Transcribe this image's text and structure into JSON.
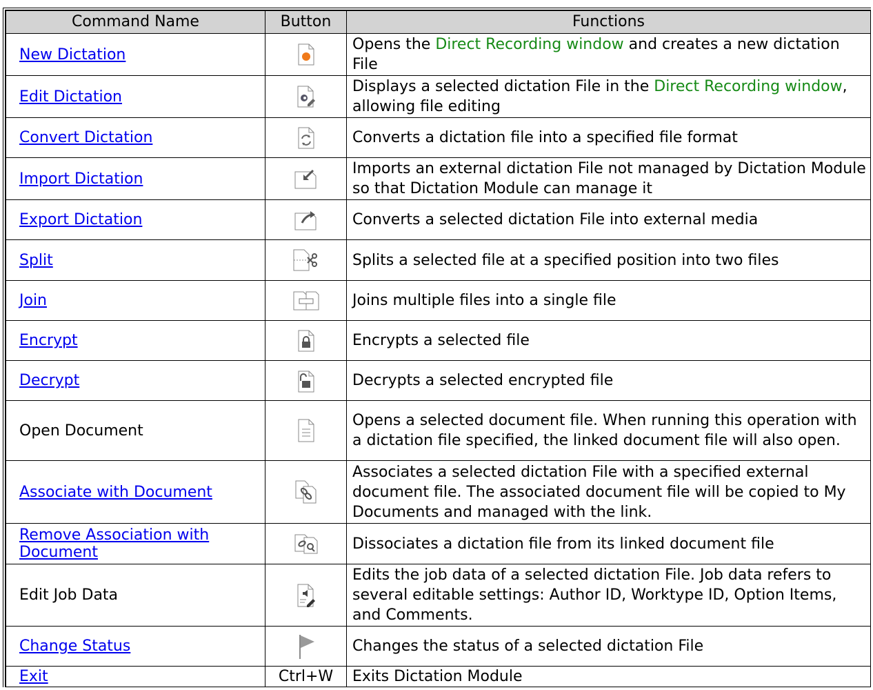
{
  "headers": {
    "command_name": "Command Name",
    "button": "Button",
    "functions": "Functions"
  },
  "rows": [
    {
      "name": "New Dictation",
      "linked": true,
      "icon": "new-dictation-icon",
      "func": [
        {
          "t": "Opens the ",
          "g": false
        },
        {
          "t": "Direct Recording window",
          "g": true
        },
        {
          "t": " and creates a new dictation File",
          "g": false
        }
      ]
    },
    {
      "name": "Edit Dictation",
      "linked": true,
      "icon": "edit-dictation-icon",
      "func": [
        {
          "t": "Displays a selected dictation File in the ",
          "g": false
        },
        {
          "t": "Direct Recording window",
          "g": true
        },
        {
          "t": ", allowing file editing",
          "g": false
        }
      ]
    },
    {
      "name": "Convert Dictation",
      "linked": true,
      "icon": "convert-dictation-icon",
      "func": [
        {
          "t": "Converts a dictation file into a specified file format",
          "g": false
        }
      ]
    },
    {
      "name": "Import Dictation",
      "linked": true,
      "icon": "import-dictation-icon",
      "func": [
        {
          "t": "Imports an external dictation File not managed by Dictation Module so that Dictation Module can manage it",
          "g": false
        }
      ]
    },
    {
      "name": "Export Dictation",
      "linked": true,
      "icon": "export-dictation-icon",
      "func": [
        {
          "t": "Converts a selected dictation File into external media",
          "g": false
        }
      ]
    },
    {
      "name": "Split",
      "linked": true,
      "icon": "split-icon",
      "func": [
        {
          "t": "Splits a selected file at a specified position into two files",
          "g": false
        }
      ]
    },
    {
      "name": "Join",
      "linked": true,
      "icon": "join-icon",
      "func": [
        {
          "t": "Joins multiple files into a single file",
          "g": false
        }
      ]
    },
    {
      "name": "Encrypt",
      "linked": true,
      "icon": "encrypt-icon",
      "func": [
        {
          "t": "Encrypts a selected file",
          "g": false
        }
      ]
    },
    {
      "name": "Decrypt",
      "linked": true,
      "icon": "decrypt-icon",
      "func": [
        {
          "t": "Decrypts a selected encrypted file",
          "g": false
        }
      ]
    },
    {
      "name": "Open Document",
      "linked": false,
      "icon": "open-document-icon",
      "func": [
        {
          "t": "Opens a selected document file. When running this operation with a dictation file specified, the linked document file will also open.",
          "g": false
        }
      ]
    },
    {
      "name": "Associate with Document",
      "linked": true,
      "icon": "associate-document-icon",
      "func": [
        {
          "t": "Associates a selected dictation File with a specified external document file. The associated document file will be copied to My Documents and managed with the link.",
          "g": false
        }
      ]
    },
    {
      "name": "Remove Association with Document",
      "linked": true,
      "icon": "remove-association-icon",
      "func": [
        {
          "t": "Dissociates a dictation file from its linked document file",
          "g": false
        }
      ]
    },
    {
      "name": "Edit Job Data",
      "linked": false,
      "icon": "edit-job-data-icon",
      "func": [
        {
          "t": "Edits the job data of a selected dictation File. Job data refers to several editable settings: Author ID, Worktype ID, Option Items, and Comments.",
          "g": false
        }
      ]
    },
    {
      "name": "Change Status",
      "linked": true,
      "icon": "change-status-icon",
      "func": [
        {
          "t": "Changes the status of a selected dictation File",
          "g": false
        }
      ]
    },
    {
      "name": "Exit",
      "linked": true,
      "icon": "",
      "shortcut": "Ctrl+W",
      "func": [
        {
          "t": "Exits Dictation Module",
          "g": false
        }
      ]
    }
  ],
  "colors": {
    "link": "#0000ee",
    "highlight_text": "#168a16",
    "header_bg": "#d3d3d3",
    "record_dot": "#f07a1a"
  }
}
